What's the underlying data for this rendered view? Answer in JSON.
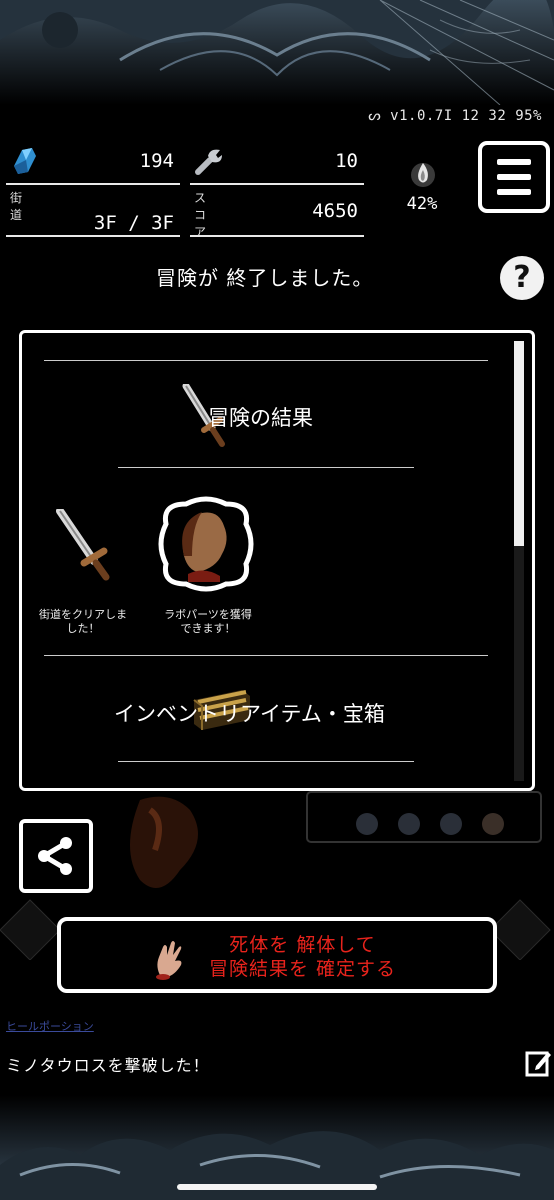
{
  "status_bar": {
    "link_symbol": "ᔕ",
    "version": "v1.0.7I",
    "time_a": "12",
    "time_b": "32",
    "battery": "95%"
  },
  "stats": {
    "crystals": "194",
    "parts": "10",
    "road_label": "街道",
    "floor": "3F / 3F",
    "score_label": "スコア",
    "score": "4650",
    "fuel": "42%"
  },
  "headline": "冒険が 終了しました。",
  "help": "?",
  "result_panel": {
    "section_result": "冒険の結果",
    "rewards": [
      {
        "caption_1": "街道をクリアしま",
        "caption_2": "した！",
        "icon": "sword-icon"
      },
      {
        "caption_1": "ラボパーツを獲得",
        "caption_2": "できます！",
        "icon": "portrait-icon"
      }
    ],
    "section_inventory": "インベントリアイテム・宝箱"
  },
  "action": {
    "line_1": "死体を 解体して",
    "line_2": "冒険結果を 確定する",
    "icon": "severed-hand-icon"
  },
  "log": {
    "faded_link": "ヒールポーション",
    "message": "ミノタウロスを撃破した！"
  },
  "colors": {
    "background": "#000000",
    "accent_red": "#e8231c",
    "border": "#ffffff"
  }
}
